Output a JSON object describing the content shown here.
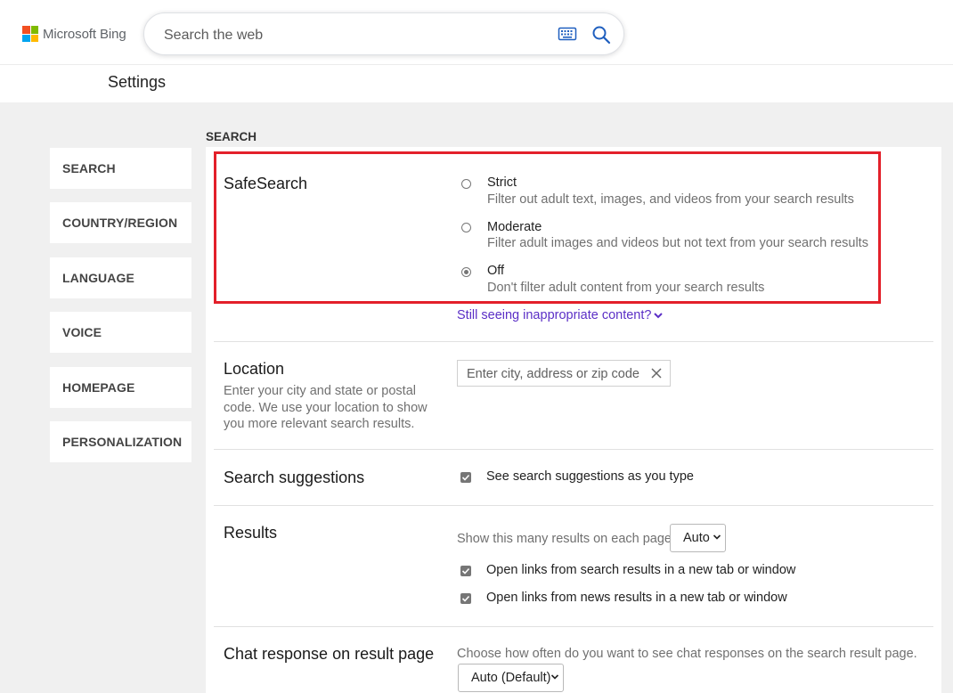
{
  "header": {
    "brand": "Microsoft Bing",
    "brand_colors": [
      "#f25022",
      "#7fba00",
      "#00a4ef",
      "#ffb900"
    ],
    "search_placeholder": "Search the web",
    "icons": [
      "keyboard-icon",
      "search-icon"
    ]
  },
  "page_title": "Settings",
  "sidebar": {
    "items": [
      {
        "label": "SEARCH"
      },
      {
        "label": "COUNTRY/REGION"
      },
      {
        "label": "LANGUAGE"
      },
      {
        "label": "VOICE"
      },
      {
        "label": "HOMEPAGE"
      },
      {
        "label": "PERSONALIZATION"
      }
    ]
  },
  "section_label": "SEARCH",
  "safesearch": {
    "title": "SafeSearch",
    "selected": "Off",
    "options": [
      {
        "label": "Strict",
        "desc": "Filter out adult text, images, and videos from your search results",
        "checked": false
      },
      {
        "label": "Moderate",
        "desc": "Filter adult images and videos but not text from your search results",
        "checked": false
      },
      {
        "label": "Off",
        "desc": "Don't filter adult content from your search results",
        "checked": true
      }
    ],
    "more_link": "Still seeing inappropriate content?",
    "highlight_color": "#e3202a"
  },
  "location": {
    "title": "Location",
    "desc_lines": [
      "Enter your city and state or postal",
      "code. We use your location to show",
      "you more relevant search results."
    ],
    "placeholder": "Enter city, address or zip code",
    "value": ""
  },
  "suggestions": {
    "title": "Search suggestions",
    "checkbox_label": "See search suggestions as you type",
    "checked": true
  },
  "results": {
    "title": "Results",
    "count_label": "Show this many results on each page",
    "count_value": "Auto",
    "options": [
      {
        "label": "Open links from search results in a new tab or window",
        "checked": true
      },
      {
        "label": "Open links from news results in a new tab or window",
        "checked": true
      }
    ]
  },
  "chat": {
    "title": "Chat response on result page",
    "desc": "Choose how often do you want to see chat responses on the search result page.",
    "value": "Auto (Default)"
  }
}
